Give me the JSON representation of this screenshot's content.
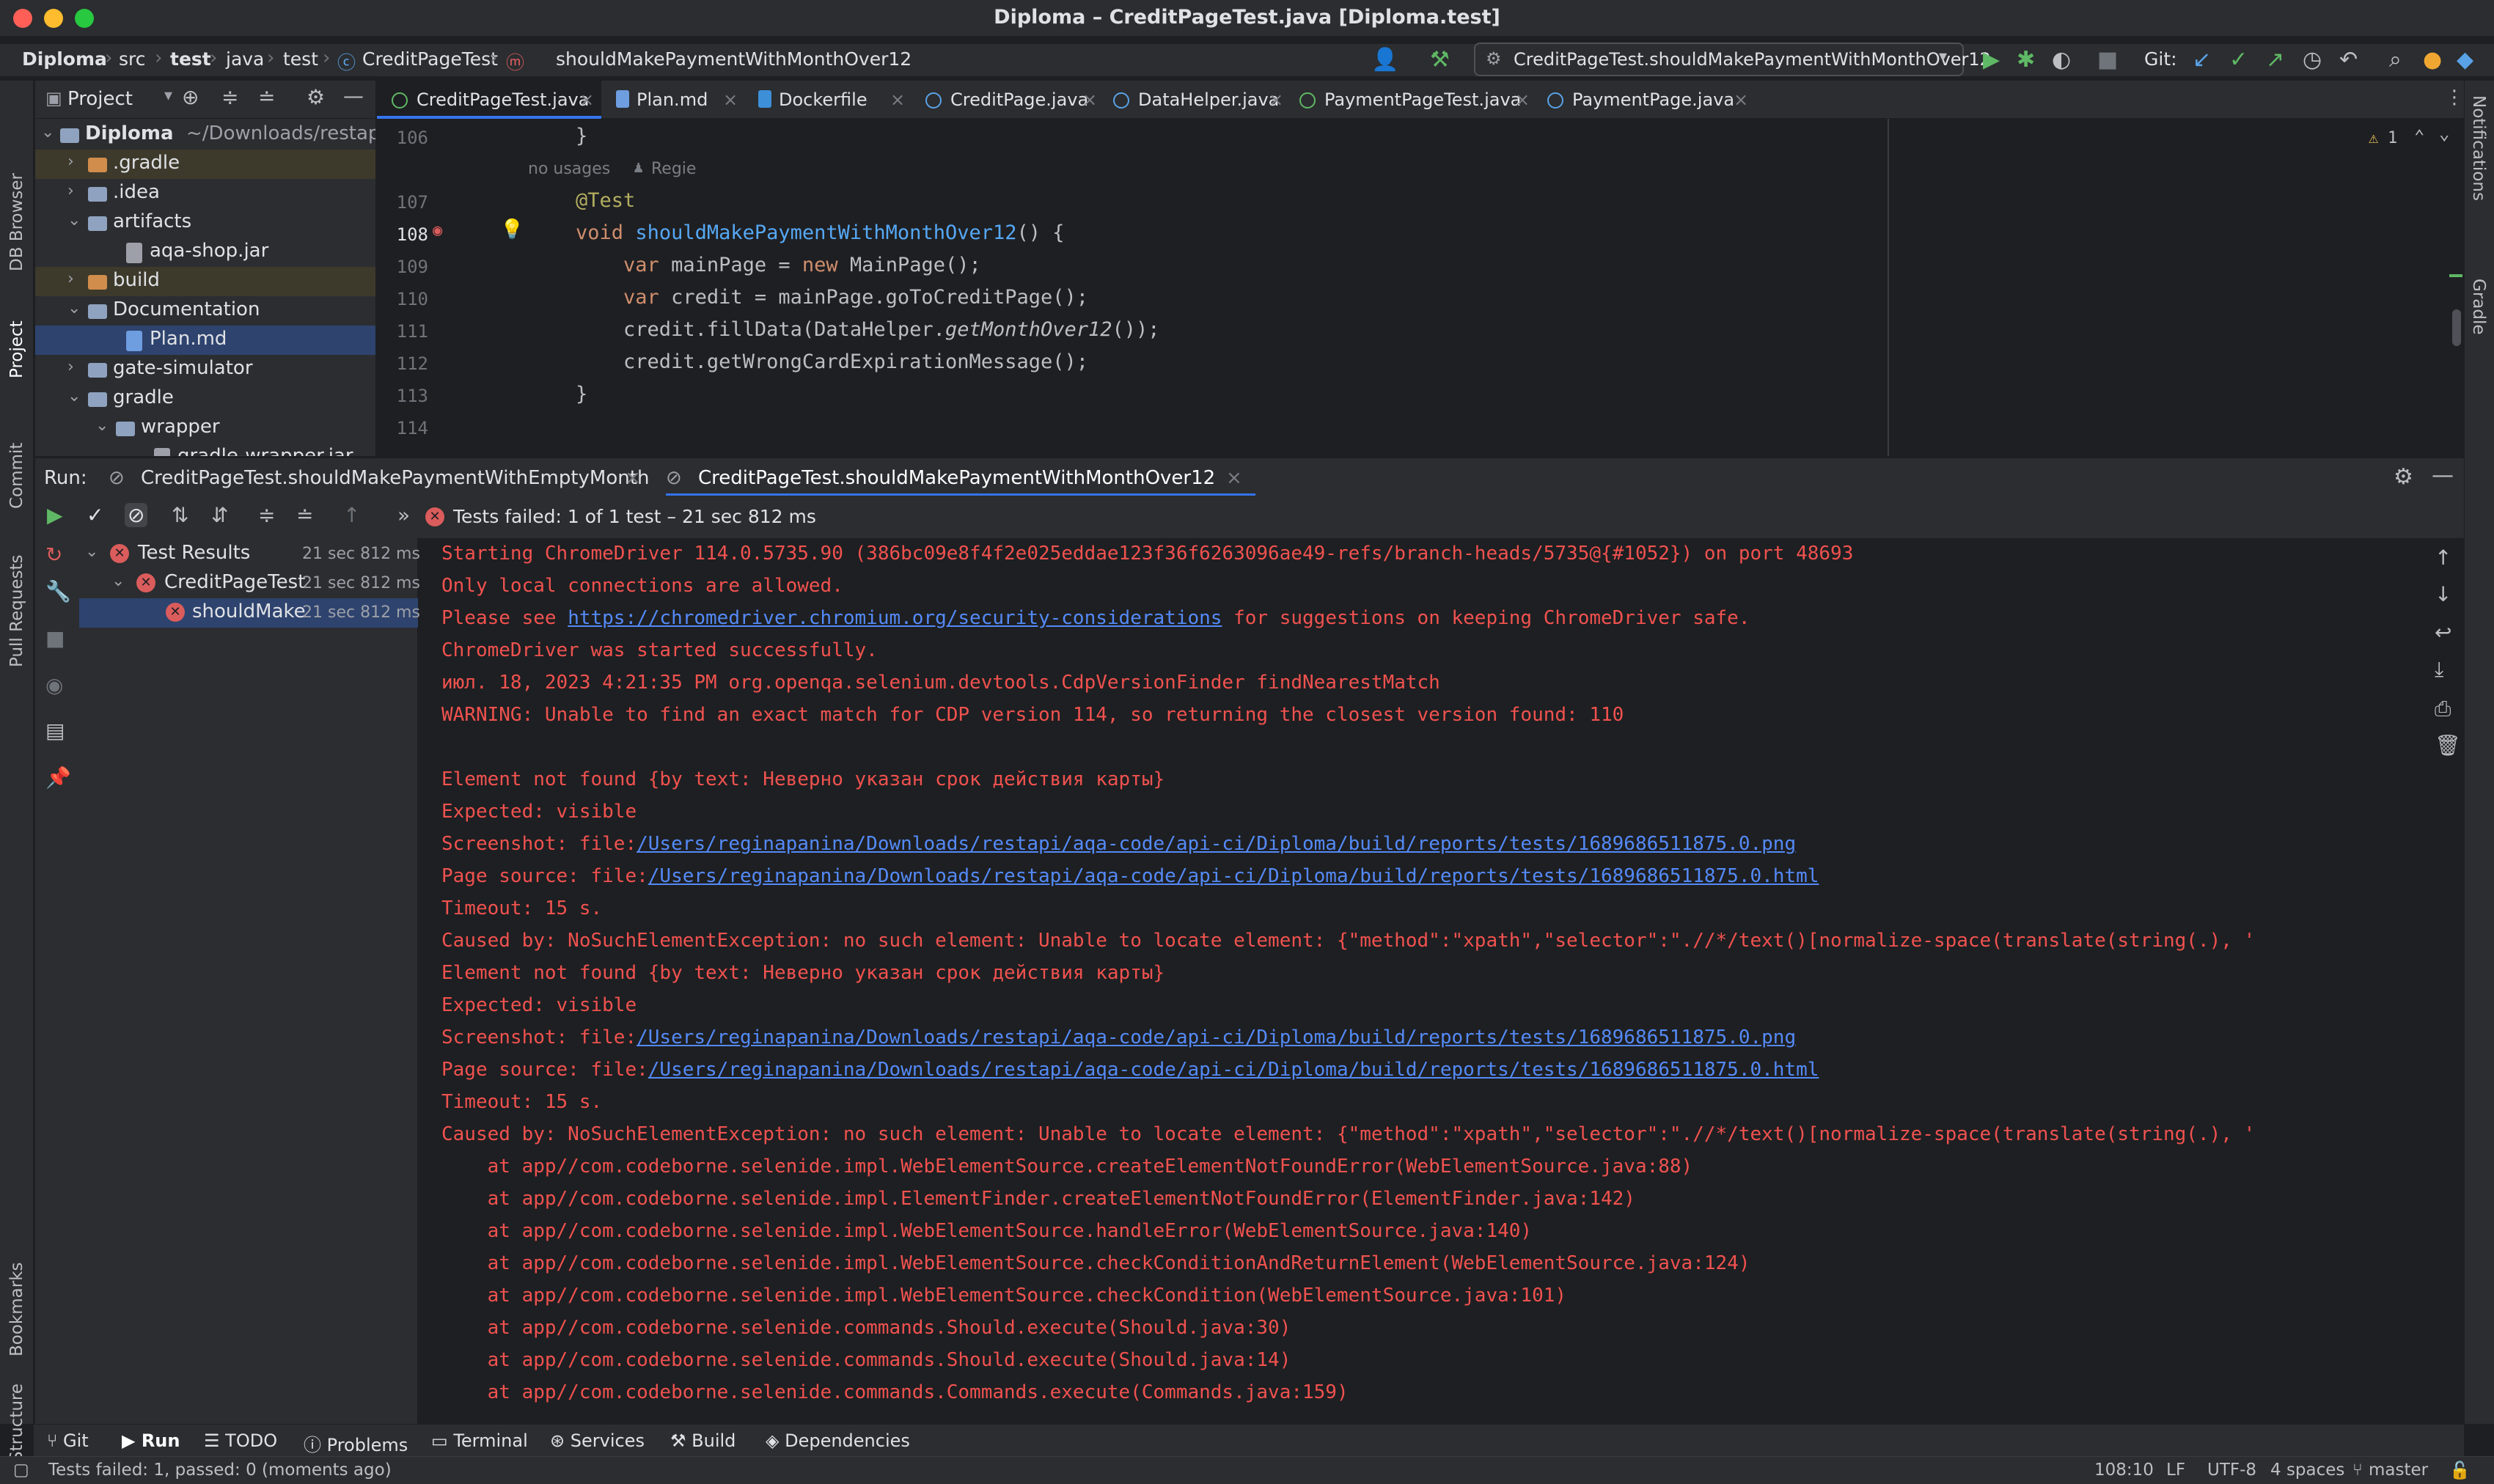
{
  "window": {
    "title": "Diploma – CreditPageTest.java [Diploma.test]"
  },
  "breadcrumb": [
    "Diploma",
    "src",
    "test",
    "java",
    "test",
    "CreditPageTest",
    "shouldMakePaymentWithMonthOver12"
  ],
  "toolbar": {
    "run_config": "CreditPageTest.shouldMakePaymentWithMonthOver12",
    "git_label": "Git:"
  },
  "left_strip": {
    "db_browser": "DB Browser",
    "project": "Project",
    "commit": "Commit",
    "pull_requests": "Pull Requests",
    "bookmarks": "Bookmarks",
    "structure": "Structure"
  },
  "right_strip": {
    "notifications": "Notifications",
    "gradle": "Gradle"
  },
  "project_panel": {
    "title": "Project",
    "tree": [
      {
        "name": "Diploma",
        "hint": "~/Downloads/restapi/a",
        "depth": 0,
        "kind": "folder",
        "open": true,
        "bold": true
      },
      {
        "name": ".gradle",
        "depth": 1,
        "kind": "folder-orange",
        "open": false
      },
      {
        "name": ".idea",
        "depth": 1,
        "kind": "folder",
        "open": false
      },
      {
        "name": "artifacts",
        "depth": 1,
        "kind": "folder",
        "open": true
      },
      {
        "name": "aqa-shop.jar",
        "depth": 2,
        "kind": "file"
      },
      {
        "name": "build",
        "depth": 1,
        "kind": "folder-orange",
        "open": false
      },
      {
        "name": "Documentation",
        "depth": 1,
        "kind": "folder",
        "open": true
      },
      {
        "name": "Plan.md",
        "depth": 2,
        "kind": "file",
        "selected": true
      },
      {
        "name": "gate-simulator",
        "depth": 1,
        "kind": "folder",
        "open": false
      },
      {
        "name": "gradle",
        "depth": 1,
        "kind": "folder",
        "open": true
      },
      {
        "name": "wrapper",
        "depth": 2,
        "kind": "folder",
        "open": true
      },
      {
        "name": "gradle-wrapper.jar",
        "depth": 3,
        "kind": "file"
      }
    ]
  },
  "editor_tabs": [
    {
      "label": "CreditPageTest.java",
      "active": true
    },
    {
      "label": "Plan.md"
    },
    {
      "label": "Dockerfile"
    },
    {
      "label": "CreditPage.java"
    },
    {
      "label": "DataHelper.java"
    },
    {
      "label": "PaymentPageTest.java"
    },
    {
      "label": "PaymentPage.java"
    }
  ],
  "editor": {
    "warning_count": "1",
    "usages_hint": "no usages",
    "author_hint": "Regie",
    "line_numbers": [
      "106",
      "107",
      "108",
      "109",
      "110",
      "111",
      "112",
      "113",
      "114"
    ],
    "lines": {
      "l106": "    }",
      "l107": "    @Test",
      "l108_kw": "    void ",
      "l108_fn": "shouldMakePaymentWithMonthOver12",
      "l108_rest": "() {",
      "l109_a": "        var",
      "l109_b": " mainPage = ",
      "l109_c": "new",
      "l109_d": " MainPage();",
      "l110_a": "        var",
      "l110_b": " credit = mainPage.goToCreditPage();",
      "l111_a": "        credit.fillData(DataHelper.",
      "l111_b": "getMonthOver12",
      "l111_c": "());",
      "l112": "        credit.getWrongCardExpirationMessage();",
      "l113": "    }"
    }
  },
  "run_panel": {
    "label": "Run:",
    "tabs": [
      "CreditPageTest.shouldMakePaymentWithEmptyMonth",
      "CreditPageTest.shouldMakePaymentWithMonthOver12"
    ],
    "status": "Tests failed: 1 of 1 test – 21 sec 812 ms",
    "results": [
      {
        "name": "Test Results",
        "time": "21 sec 812 ms",
        "depth": 0
      },
      {
        "name": "CreditPageTest",
        "time": "21 sec 812 ms",
        "depth": 1
      },
      {
        "name": "shouldMake",
        "time": "21 sec 812 ms",
        "depth": 2,
        "selected": true
      }
    ],
    "console": [
      "Starting ChromeDriver 114.0.5735.90 (386bc09e8f4f2e025eddae123f36f6263096ae49-refs/branch-heads/5735@{#1052}) on port 48693",
      "Only local connections are allowed.",
      {
        "pre": "Please see ",
        "link": "https://chromedriver.chromium.org/security-considerations",
        "post": " for suggestions on keeping ChromeDriver safe."
      },
      "ChromeDriver was started successfully.",
      "июл. 18, 2023 4:21:35 PM org.openqa.selenium.devtools.CdpVersionFinder findNearestMatch",
      "WARNING: Unable to find an exact match for CDP version 114, so returning the closest version found: 110",
      "",
      "Element not found {by text: Неверно указан срок действия карты}",
      "Expected: visible",
      {
        "pre": "Screenshot: file:",
        "link": "/Users/reginapanina/Downloads/restapi/aqa-code/api-ci/Diploma/build/reports/tests/1689686511875.0.png",
        "post": ""
      },
      {
        "pre": "Page source: file:",
        "link": "/Users/reginapanina/Downloads/restapi/aqa-code/api-ci/Diploma/build/reports/tests/1689686511875.0.html",
        "post": ""
      },
      "Timeout: 15 s.",
      "Caused by: NoSuchElementException: no such element: Unable to locate element: {\"method\":\"xpath\",\"selector\":\".//*/text()[normalize-space(translate(string(.), '",
      "Element not found {by text: Неверно указан срок действия карты}",
      "Expected: visible",
      {
        "pre": "Screenshot: file:",
        "link": "/Users/reginapanina/Downloads/restapi/aqa-code/api-ci/Diploma/build/reports/tests/1689686511875.0.png",
        "post": ""
      },
      {
        "pre": "Page source: file:",
        "link": "/Users/reginapanina/Downloads/restapi/aqa-code/api-ci/Diploma/build/reports/tests/1689686511875.0.html",
        "post": ""
      },
      "Timeout: 15 s.",
      "Caused by: NoSuchElementException: no such element: Unable to locate element: {\"method\":\"xpath\",\"selector\":\".//*/text()[normalize-space(translate(string(.), '",
      "    at app//com.codeborne.selenide.impl.WebElementSource.createElementNotFoundError(WebElementSource.java:88)",
      "    at app//com.codeborne.selenide.impl.ElementFinder.createElementNotFoundError(ElementFinder.java:142)",
      "    at app//com.codeborne.selenide.impl.WebElementSource.handleError(WebElementSource.java:140)",
      "    at app//com.codeborne.selenide.impl.WebElementSource.checkConditionAndReturnElement(WebElementSource.java:124)",
      "    at app//com.codeborne.selenide.impl.WebElementSource.checkCondition(WebElementSource.java:101)",
      "    at app//com.codeborne.selenide.commands.Should.execute(Should.java:30)",
      "    at app//com.codeborne.selenide.commands.Should.execute(Should.java:14)",
      "    at app//com.codeborne.selenide.commands.Commands.execute(Commands.java:159)"
    ]
  },
  "bottom_tabs": [
    "Git",
    "Run",
    "TODO",
    "Problems",
    "Terminal",
    "Services",
    "Build",
    "Dependencies"
  ],
  "status_bar": {
    "message": "Tests failed: 1, passed: 0 (moments ago)",
    "position": "108:10",
    "line_sep": "LF",
    "encoding": "UTF-8",
    "indent": "4 spaces",
    "branch": "master"
  }
}
